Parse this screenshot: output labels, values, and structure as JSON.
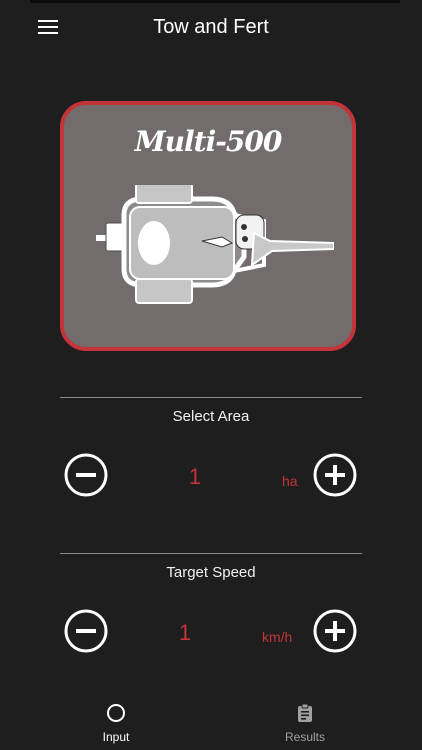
{
  "header": {
    "title": "Tow and Fert",
    "menu_icon": "menu-icon"
  },
  "machine": {
    "model_name": "Multi-500",
    "image": "fertilizer-spreader-illustration"
  },
  "area": {
    "label": "Select Area",
    "value": "1",
    "unit": "ha"
  },
  "speed": {
    "label": "Target Speed",
    "value": "1",
    "unit": "km/h"
  },
  "tabs": [
    {
      "label": "Input",
      "icon": "circle-icon",
      "active": true
    },
    {
      "label": "Results",
      "icon": "clipboard-icon",
      "active": false
    }
  ],
  "colors": {
    "accent": "#c3343a",
    "background": "#1e1e1f",
    "card": "#726d6c"
  }
}
